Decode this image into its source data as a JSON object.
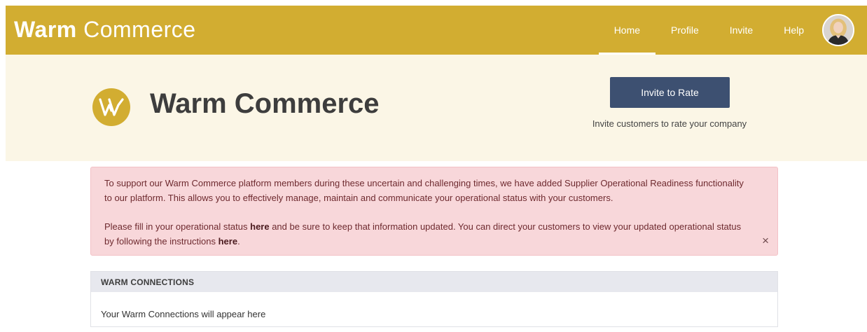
{
  "header": {
    "brand_bold": "Warm",
    "brand_light": "Commerce",
    "nav": [
      {
        "label": "Home",
        "active": true
      },
      {
        "label": "Profile",
        "active": false
      },
      {
        "label": "Invite",
        "active": false
      },
      {
        "label": "Help",
        "active": false
      }
    ],
    "avatar_icon": "user-avatar"
  },
  "hero": {
    "logo_icon": "warm-commerce-w-logo",
    "title": "Warm Commerce",
    "invite_button": "Invite to Rate",
    "invite_caption": "Invite customers to rate your company"
  },
  "alert": {
    "para1": "To support our Warm Commerce platform members during these uncertain and challenging times, we have added Supplier Operational Readiness functionality to our platform. This allows you to effectively manage, maintain and communicate your operational status with your customers.",
    "para2_a": "Please fill in your operational status ",
    "para2_link1": "here",
    "para2_b": " and be sure to keep that information updated. You can direct your customers to view your updated operational status by following the instructions ",
    "para2_link2": "here",
    "para2_c": ".",
    "close": "×"
  },
  "connections": {
    "heading": "WARM CONNECTIONS",
    "empty_text": "Your Warm Connections will appear here"
  },
  "colors": {
    "brand_gold": "#d2ad31",
    "hero_bg": "#fbf6e6",
    "button_navy": "#3d5071",
    "alert_bg": "#f8d7da"
  }
}
